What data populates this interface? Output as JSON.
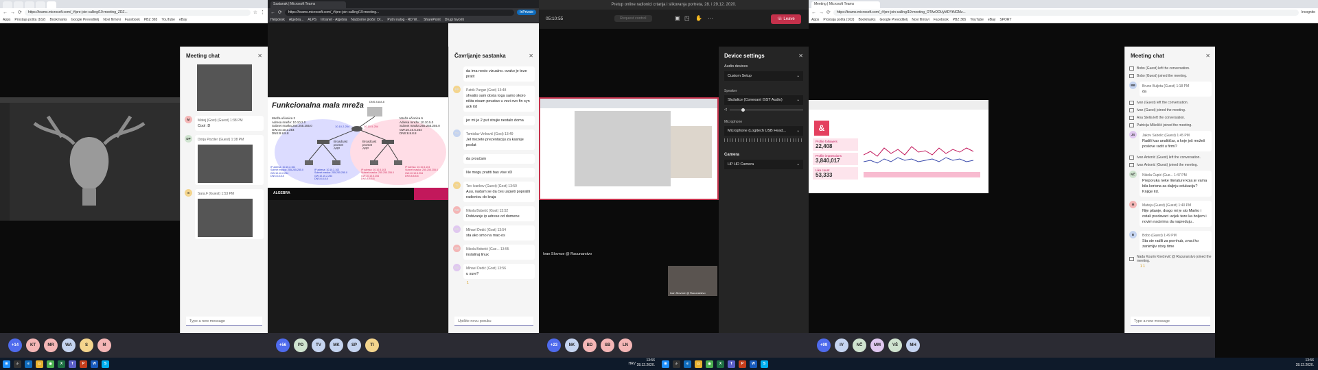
{
  "pane1": {
    "tabs": [
      {
        "label": "",
        "active": false
      },
      {
        "label": "",
        "active": false
      },
      {
        "label": "",
        "active": false
      },
      {
        "label": "",
        "active": false
      },
      {
        "label": "",
        "active": true
      }
    ],
    "url": "https://teams.microsoft.com/_#/pre-join-calling/19:meeting_ZDZ...",
    "bookmarks": [
      "Apps",
      "Prostaja pošta (162)",
      "Bookmarks",
      "Google Prevoditelj",
      "Novi filmovi",
      "Facebook",
      "PBZ 365",
      "YouTube",
      "eBay"
    ],
    "chat_title": "Meeting chat",
    "messages": [
      {
        "initials": "M",
        "avatar_color": "#f4b6b6",
        "author": "Matej (Gost) (Guest)",
        "time": "1:38 PM",
        "text": "Cool :D",
        "has_image": false
      },
      {
        "initials": "DP",
        "avatar_color": "#cfe3cf",
        "author": "Dorja Pozder (Guest)",
        "time": "1:38 PM",
        "text": "",
        "has_image": true
      },
      {
        "initials": "S",
        "avatar_color": "#f4d58d",
        "author": "Sara.F (Guest)",
        "time": "1:53 PM",
        "text": "",
        "has_image": true
      }
    ],
    "compose_placeholder": "Type a new message",
    "participants": [
      {
        "label": "+14",
        "color": "#4f6bed"
      },
      {
        "label": "KT",
        "color": "#f4b6b6"
      },
      {
        "label": "MR",
        "color": "#f4b6b6"
      },
      {
        "label": "WA",
        "color": "#c5d4f0"
      },
      {
        "label": "S",
        "color": "#f4d58d"
      },
      {
        "label": "M",
        "color": "#f4b6b6"
      }
    ]
  },
  "pane2": {
    "tab_title": "Sastanak | Microsoft Teams",
    "url": "https://teams.microsoft.com/_#/pre-join-calling/19:meeting...",
    "profile": "InPrivate",
    "bookmarks": [
      "Helpdesk",
      "Algebra...",
      "ALPS",
      "Intranet - Algebra",
      "Nadzorne ploče: Dr...",
      "Putni nalog - RD W...",
      "SharePoint",
      "Drugi favoriti"
    ],
    "slide": {
      "title": "Funkcionalna mala mreža",
      "dns_label": "DNS 8.8.8.8",
      "left_network": "Mreža učionica 2\nAdresa mreže: 10.10.2.0\nSubnet maska:255.255.255.0\nGW:10.10.2.254\nDNS:8.8.8.8",
      "right_network": "Mreža učionica 6\nAdresa mreže: 10.10.5.0\nSubnet maska:255.255.255.0\nGW:10.10.5.254\nDNS:8.8.8.8",
      "router_left_ip": "10.10.2.254",
      "router_right_ip": "10.10.5.254",
      "broadcast_left": "Broadcast\npromet\nARP",
      "broadcast_right": "Broadcast\npromet\nARP",
      "host1": "IP adresa: 10.10.2.101\nSubnet maska: 255.255.255.0\nGW:10.10.2.254\nDNS:8.8.8.8",
      "host2": "IP adresa: 10.10.2.102\nSubnet maska: 255.255.255.0\nGW:10.10.2.254\nDNS:8.8.8.8",
      "host3": "IP adresa: 10.10.5.103\nSubnet maska: 255.255.255.0\nGW:10.10.5.254\nDNS:8.8.8.8",
      "host4": "IP adresa: 10.10.5.104\nSubnet maska: 255.255.255.0\nGW:10.10.5.254\nDNS:8.8.8.8",
      "brand": "ALGEBRA"
    },
    "chat_title": "Čavrljanje sastanka",
    "messages": [
      {
        "initials": "",
        "avatar_color": "",
        "author": "",
        "time": "",
        "text": "da ima nesto vizualno. ovako je teze pratit"
      },
      {
        "initials": "PP",
        "avatar_color": "#f4d58d",
        "author": "Patrik Purgar (Gost)",
        "time": "13:48",
        "text": "shvatio sam dosta toga samo skoro ništa nisam povatao u vezi ovo fin syn ack itd"
      },
      {
        "initials": "",
        "avatar_color": "",
        "author": "",
        "time": "",
        "text": "jer mi je 2 put strujie nestalo doma"
      },
      {
        "initials": "TV",
        "avatar_color": "#c5d4f0",
        "author": "Tomislav Vinković (Gost)",
        "time": "13:49",
        "text": "Jel mozete prezentaciju za kasnije poslat"
      },
      {
        "initials": "",
        "avatar_color": "",
        "author": "",
        "time": "",
        "text": "da proučam"
      },
      {
        "initials": "",
        "avatar_color": "",
        "author": "",
        "time": "",
        "text": "Ne mogu pratiti bas vise xD"
      },
      {
        "initials": "TI",
        "avatar_color": "#f4d58d",
        "author": "Teo Ivankov (Guest) (Gost)",
        "time": "13:50",
        "text": "Auu, nadam se da ćes uspjeti popratiti radionicu do kraja"
      },
      {
        "initials": "NB",
        "avatar_color": "#f4b6b6",
        "author": "Nikola Bobetić (Gost)",
        "time": "13:52",
        "text": "Dobivanje ip adrese od domene"
      },
      {
        "initials": "MD",
        "avatar_color": "#e0c8f0",
        "author": "Mihael Dedić (Gost)",
        "time": "13:54",
        "text": "sta ako smo na mac-os"
      },
      {
        "initials": "NB",
        "avatar_color": "#f4b6b6",
        "author": "Nikola Bobetić (Gue...",
        "time": "13:55",
        "text": "instaliraj linux"
      },
      {
        "initials": "MD",
        "avatar_color": "#e0c8f0",
        "author": "Mihael Dedić (Gost)",
        "time": "13:56",
        "text": "u sure?"
      }
    ],
    "reaction": "1",
    "compose_placeholder": "Upišite novu poruku",
    "participants": [
      {
        "label": "+56",
        "color": "#4f6bed"
      },
      {
        "label": "PD",
        "color": "#cfe3cf"
      },
      {
        "label": "TV",
        "color": "#c5d4f0"
      },
      {
        "label": "MK",
        "color": "#c5d4f0"
      },
      {
        "label": "SP",
        "color": "#c5d4f0"
      },
      {
        "label": "TI",
        "color": "#f4d58d"
      }
    ]
  },
  "pane3": {
    "window_title": "Pretup online radionici crtanja i slikovanja portreta, 28. i 29.12. 2020.",
    "timer": "05:10:55",
    "record_label": "Request control",
    "leave_label": "Leave",
    "settings_title": "Device settings",
    "audio_devices_label": "Audio devices",
    "audio_device": "Custom Setup",
    "speaker_label": "Speaker",
    "speaker": "Slušalice (Conexant ISST Audio)",
    "microphone_label": "Microphone",
    "microphone": "Microphone (Logitech USB Head...",
    "camera_section": "Camera",
    "camera": "HP HD Camera",
    "presenter": "Ivan Slovnce @ Racunarstvo",
    "tile_name": "Ivan Slovnce @ Racunarstvo",
    "participants": [
      {
        "label": "+23",
        "color": "#4f6bed"
      },
      {
        "label": "NK",
        "color": "#c5d4f0"
      },
      {
        "label": "BD",
        "color": "#f4b6b6"
      },
      {
        "label": "SB",
        "color": "#f4b6b6"
      },
      {
        "label": "LN",
        "color": "#f4b6b6"
      }
    ]
  },
  "pane4": {
    "tab_title": "Meeting | Microsoft Teams",
    "url": "https://teams.microsoft.com/_#/pre-join-calling/19:meeting_OTAzODUyMDYtNGMz...",
    "profile": "Incognito",
    "bookmarks": [
      "Apps",
      "Prostaja pošta (162)",
      "Bookmarks",
      "Google Prevoditelj",
      "Novi filmovi",
      "Facebook",
      "PBZ 365",
      "YouTube",
      "eBay",
      "SPORT"
    ],
    "shared_stats": [
      {
        "label": "Profile followers",
        "value": "22,408"
      },
      {
        "label": "Profile impressions",
        "value": "3,840,017"
      },
      {
        "label": "Like count",
        "value": "53,333"
      }
    ],
    "chat_title": "Meeting chat",
    "feed": [
      {
        "type": "sys",
        "text": "Bobo (Guest) left the conversation."
      },
      {
        "type": "sys",
        "text": "Bobo (Guest) joined the meeting."
      },
      {
        "type": "msg",
        "initials": "BB",
        "avatar_color": "#c5d4f0",
        "author": "Bruno Buljeta (Guest)",
        "time": "1:18 PM",
        "text": "da"
      },
      {
        "type": "sys",
        "text": "Ivan (Guest) left the conversation."
      },
      {
        "type": "sys",
        "text": "Ivan (Guest) joined the meeting."
      },
      {
        "type": "sys",
        "text": "Ana Stella left the conversation."
      },
      {
        "type": "sys",
        "text": "Patricija Mikolčić joined the meeting."
      },
      {
        "type": "msg",
        "initials": "JS",
        "avatar_color": "#e0c8f0",
        "author": "Jakov Sabolic (Guest)",
        "time": "1:45 PM",
        "text": "Radili kao analitičar, a koje još možeš poslove radit u firmi?"
      },
      {
        "type": "sys",
        "text": "Ivan Antonić (Guest) left the conversation."
      },
      {
        "type": "sys",
        "text": "Ivan Antonić (Guest) joined the meeting."
      },
      {
        "type": "msg",
        "initials": "NČ",
        "avatar_color": "#cfe3cf",
        "author": "Nikola Ćupić (Gue...",
        "time": "1:47 PM",
        "text": "Preporuka neke literature koja je vama bila korisna za daljnju edukaciju? Knjige itd."
      },
      {
        "type": "msg",
        "initials": "M",
        "avatar_color": "#f4b6b6",
        "author": "Mateja (Guest) (Guest)",
        "time": "1:40 PM",
        "text": "Nije pitanje, drago mi je sto Marko i ostali predavaci uvijek teze ka boljem i novim nacinima da napreduju.."
      },
      {
        "type": "msg",
        "initials": "B",
        "avatar_color": "#c5d4f0",
        "author": "Bobo (Guest)",
        "time": "1:49 PM",
        "text": "Sta ste radili za pornhub, zvuci ko zanimljiv story time"
      },
      {
        "type": "sys",
        "text": "Nada Kourin Kneževič @ Racunarstvo joined the meeting."
      }
    ],
    "reaction_likes": "1",
    "reaction_hearts": "1",
    "compose_placeholder": "Type a new message",
    "participants": [
      {
        "label": "+99",
        "color": "#4f6bed"
      },
      {
        "label": "IV",
        "color": "#c5d4f0"
      },
      {
        "label": "NČ",
        "color": "#cfe3cf"
      },
      {
        "label": "MM",
        "color": "#e0c8f0"
      },
      {
        "label": "VŠ",
        "color": "#cfe3cf"
      },
      {
        "label": "MH",
        "color": "#c5d4f0"
      }
    ]
  },
  "taskbar": {
    "left_time": "13:56",
    "left_date": "28.12.2020.",
    "left_lang": "HRV",
    "right_time": "13:56",
    "right_date": "28.12.2020."
  }
}
